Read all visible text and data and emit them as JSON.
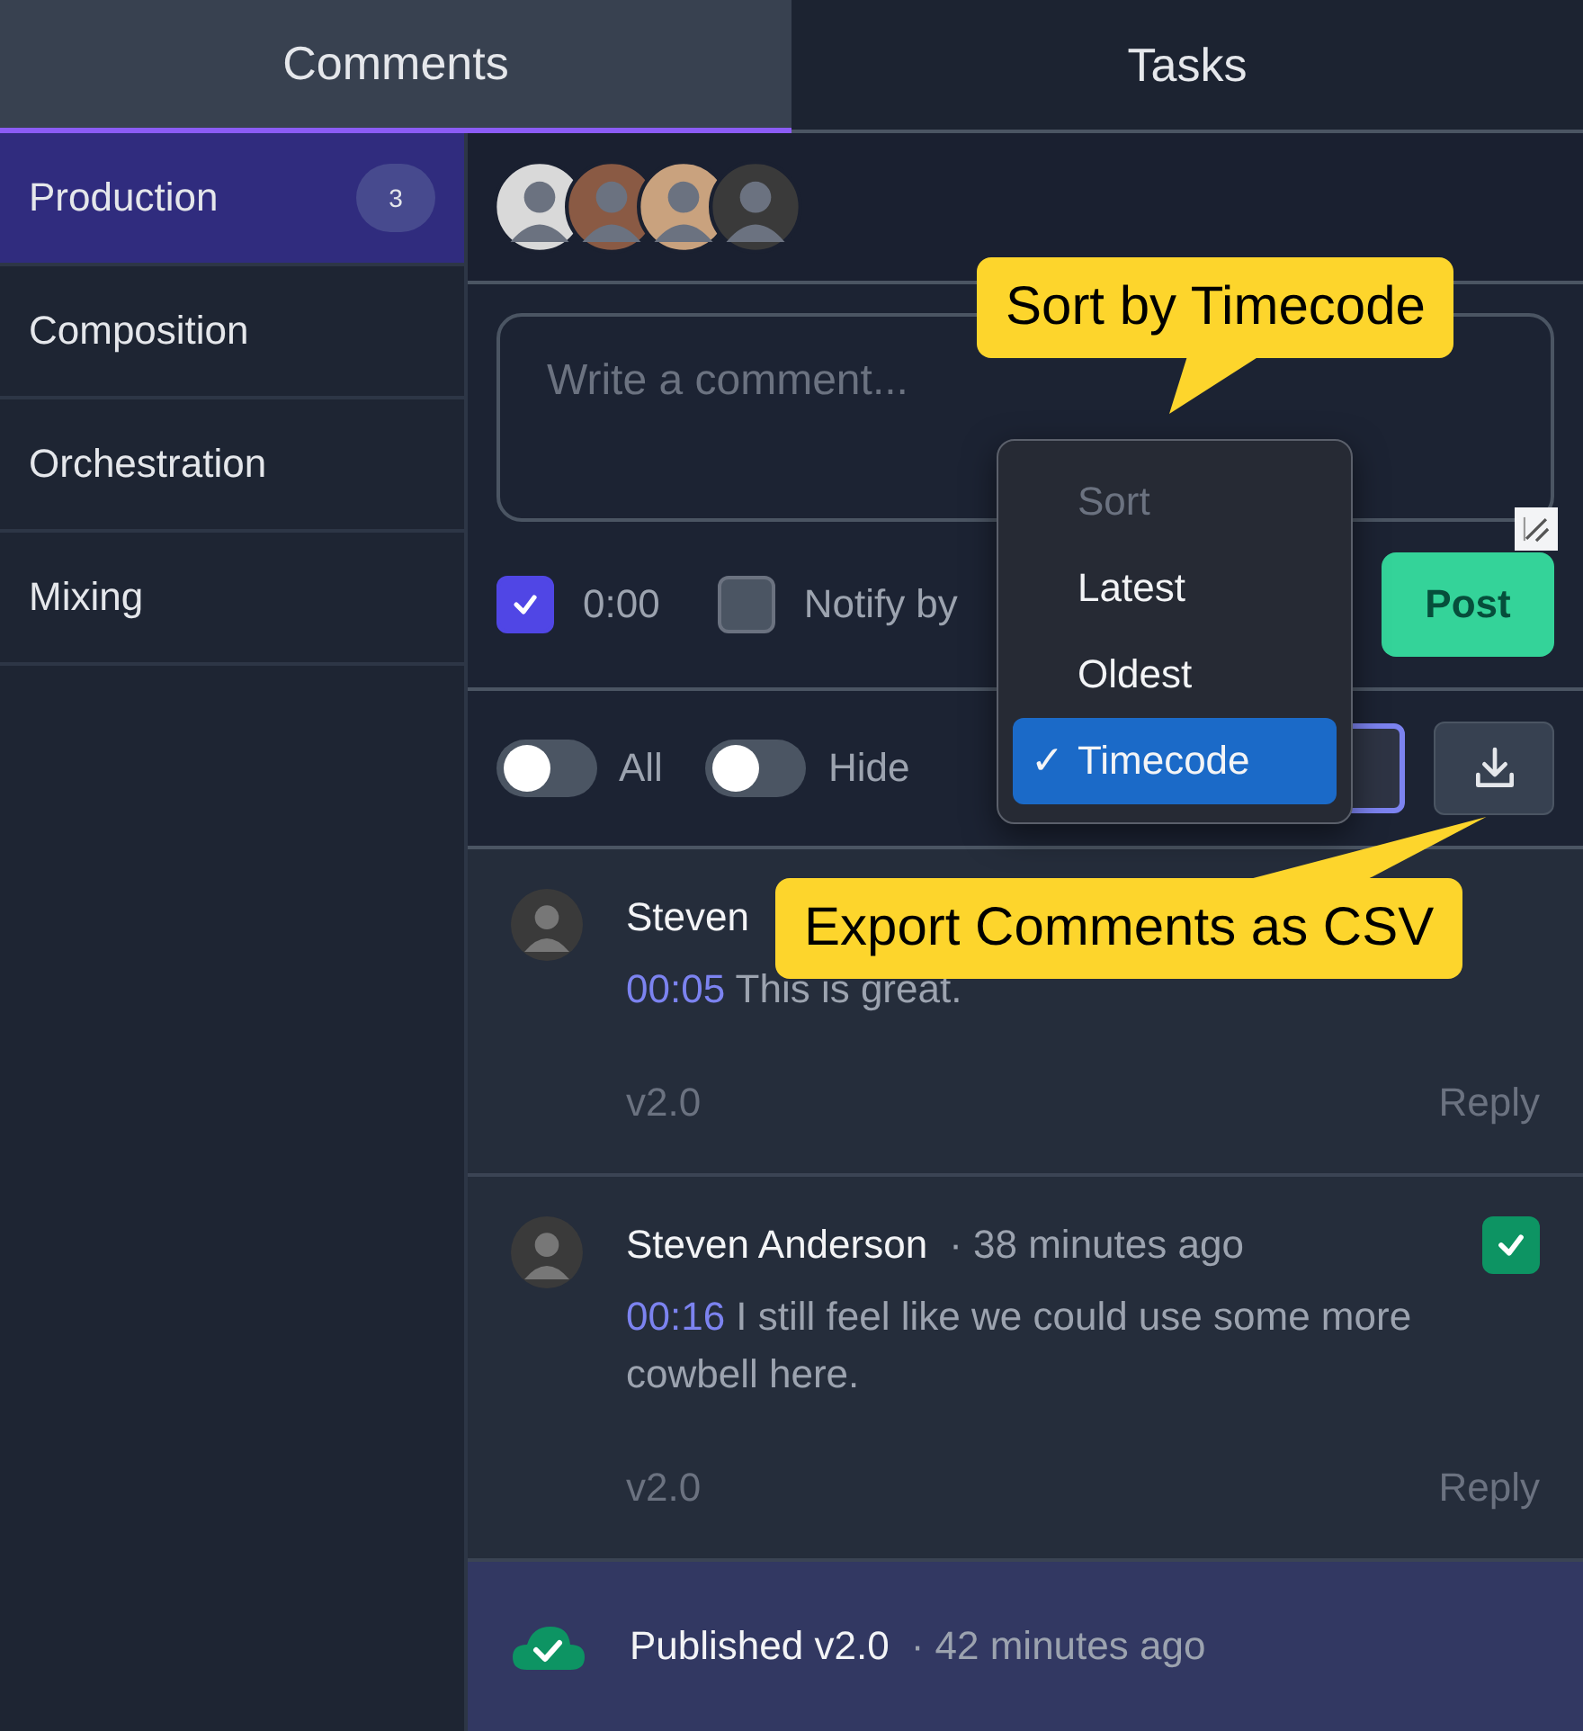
{
  "tabs": [
    {
      "label": "Comments",
      "selected": true
    },
    {
      "label": "Tasks",
      "selected": false
    }
  ],
  "sidebar": {
    "items": [
      {
        "label": "Production",
        "badge": "3",
        "selected": true
      },
      {
        "label": "Composition",
        "selected": false
      },
      {
        "label": "Orchestration",
        "selected": false
      },
      {
        "label": "Mixing",
        "selected": false
      }
    ]
  },
  "composer": {
    "placeholder": "Write a comment...",
    "timecode_checked": true,
    "timecode": "0:00",
    "notify_checked": false,
    "notify_label": "Notify by",
    "post": "Post"
  },
  "filters": [
    {
      "label": "All",
      "on": false
    },
    {
      "label": "Hide",
      "on": false
    }
  ],
  "sort_menu": {
    "heading": "Sort",
    "check": "✓",
    "options": [
      {
        "label": "Latest",
        "selected": false
      },
      {
        "label": "Oldest",
        "selected": false
      },
      {
        "label": "Timecode",
        "selected": true
      }
    ]
  },
  "tooltips": [
    {
      "text": "Sort by Timecode"
    },
    {
      "text": "Export Comments as CSV"
    }
  ],
  "comments": [
    {
      "author": "Steven",
      "timecode": "00:05",
      "text": "This is great.",
      "version": "v2.0",
      "reply": "Reply"
    },
    {
      "author": "Steven Anderson",
      "ago": "· 38 minutes ago",
      "timecode": "00:16",
      "text": "I still feel like we could use some more cowbell here.",
      "version": "v2.0",
      "reply": "Reply",
      "resolved": true
    }
  ],
  "activity": {
    "text": "Published v2.0",
    "ago": "· 42 minutes ago"
  }
}
